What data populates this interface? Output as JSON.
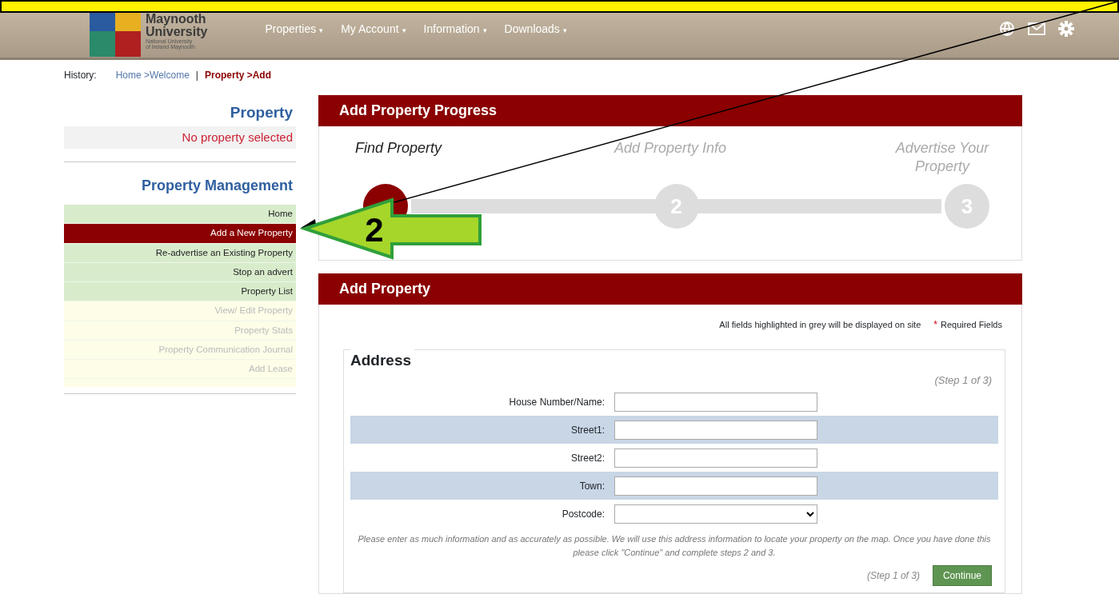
{
  "annotation": {
    "callout_number": "2"
  },
  "header": {
    "logo_lines": [
      "Maynooth",
      "University",
      "National University",
      "of Ireland Maynooth"
    ],
    "nav": [
      {
        "label": "Properties",
        "caret": "▾"
      },
      {
        "label": "My Account",
        "caret": "▾"
      },
      {
        "label": "Information",
        "caret": "▾"
      },
      {
        "label": "Downloads",
        "caret": "▾"
      }
    ]
  },
  "history": {
    "label": "History:",
    "separator": "|",
    "links": [
      {
        "label": "Home >Welcome",
        "selected": false
      },
      {
        "label": "Property >Add",
        "selected": true
      }
    ]
  },
  "sidebar": {
    "property_title": "Property",
    "property_status": "No property selected",
    "management_title": "Property Management",
    "items": [
      {
        "label": "Home",
        "selected": false,
        "disabled": false
      },
      {
        "label": "Add a New Property",
        "selected": true,
        "disabled": false
      },
      {
        "label": "Re-advertise an Existing Property",
        "selected": false,
        "disabled": false
      },
      {
        "label": "Stop an advert",
        "selected": false,
        "disabled": false
      },
      {
        "label": "Property List",
        "selected": false,
        "disabled": false
      },
      {
        "label": "View/ Edit Property",
        "selected": false,
        "disabled": true
      },
      {
        "label": "Property Stats",
        "selected": false,
        "disabled": true
      },
      {
        "label": "Property Communication Journal",
        "selected": false,
        "disabled": true
      },
      {
        "label": "Add Lease",
        "selected": false,
        "disabled": true
      }
    ]
  },
  "progress": {
    "title": "Add Property Progress",
    "steps": [
      {
        "label": "Find Property",
        "selected": true
      },
      {
        "label": "Add Property Info",
        "number": "2",
        "selected": false
      },
      {
        "label": "Advertise Your Property",
        "number": "3",
        "selected": false
      }
    ]
  },
  "form": {
    "title": "Add Property",
    "note": "All fields highlighted in grey will be displayed on site",
    "required_mark": "*",
    "required_label": "Required Fields",
    "legend": "Address",
    "step_top": "(Step 1 of 3)",
    "fields": [
      {
        "label": "House Number/Name:",
        "kind": "input",
        "highlighted": false
      },
      {
        "label": "Street1:",
        "kind": "input",
        "highlighted": true
      },
      {
        "label": "Street2:",
        "kind": "input",
        "highlighted": false
      },
      {
        "label": "Town:",
        "kind": "input",
        "highlighted": true
      },
      {
        "label": "Postcode:",
        "kind": "select",
        "highlighted": false
      }
    ],
    "help": "Please enter as much information and as accurately as possible. We will use this address information to locate your property on the map. Once you have done this please click \"Continue\" and complete steps 2 and 3.",
    "step_bottom": "(Step 1 of 3)",
    "button": "Continue"
  }
}
